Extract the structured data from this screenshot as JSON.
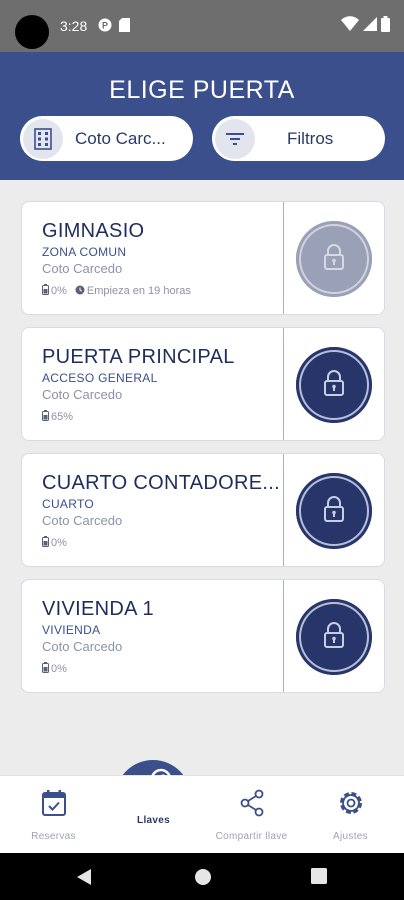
{
  "status_bar": {
    "time": "3:28"
  },
  "header": {
    "title": "ELIGE PUERTA",
    "location_label": "Coto Carc...",
    "filter_label": "Filtros"
  },
  "doors": [
    {
      "name": "GIMNASIO",
      "type": "ZONA COMUN",
      "location": "Coto Carcedo",
      "battery": "0%",
      "extra": "Empieza en 19 horas",
      "state": "disabled"
    },
    {
      "name": "PUERTA PRINCIPAL",
      "type": "ACCESO GENERAL",
      "location": "Coto Carcedo",
      "battery": "65%",
      "extra": "",
      "state": "active"
    },
    {
      "name": "CUARTO CONTADORE...",
      "type": "CUARTO",
      "location": "Coto Carcedo",
      "battery": "0%",
      "extra": "",
      "state": "active"
    },
    {
      "name": "VIVIENDA 1",
      "type": "VIVIENDA",
      "location": "Coto Carcedo",
      "battery": "0%",
      "extra": "",
      "state": "active"
    }
  ],
  "nav": {
    "reservas": "Reservas",
    "llaves": "Llaves",
    "compartir": "Compartir llave",
    "ajustes": "Ajustes"
  },
  "colors": {
    "primary": "#3b4f8c",
    "dark": "#27356a",
    "disabled": "#9aa0b6"
  }
}
